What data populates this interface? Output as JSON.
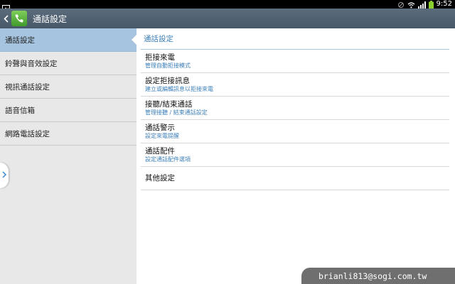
{
  "status_bar": {
    "time": "9:52",
    "icons": [
      "image-icon",
      "mute-icon",
      "wifi-icon",
      "signal-icon",
      "battery-icon"
    ]
  },
  "action_bar": {
    "title": "通話設定",
    "icon": "phone-icon"
  },
  "sidebar": {
    "items": [
      {
        "label": "通話設定",
        "selected": true
      },
      {
        "label": "鈴聲與音效設定",
        "selected": false
      },
      {
        "label": "視訊通話設定",
        "selected": false
      },
      {
        "label": "語音信箱",
        "selected": false
      },
      {
        "label": "網路電話設定",
        "selected": false
      }
    ]
  },
  "main": {
    "section_title": "通話設定",
    "items": [
      {
        "title": "拒接來電",
        "subtitle": "管理自動拒接模式"
      },
      {
        "title": "設定拒接訊息",
        "subtitle": "建立或編輯訊息以拒接來電"
      },
      {
        "title": "接聽/結束通話",
        "subtitle": "管理接聽 / 結束通話設定"
      },
      {
        "title": "通話警示",
        "subtitle": "設定來電提醒"
      },
      {
        "title": "通話配件",
        "subtitle": "設定通話配件選項"
      },
      {
        "title": "其他設定"
      }
    ]
  },
  "watermark": "brianli813@sogi.com.tw",
  "colors": {
    "status_bar_bg": "#000000",
    "action_bar_bg": "#4f6070",
    "sidebar_bg": "#e8e8e8",
    "selected_bg": "#a6c4df",
    "accent": "#3d7fb8",
    "battery": "#8ccf2f"
  }
}
